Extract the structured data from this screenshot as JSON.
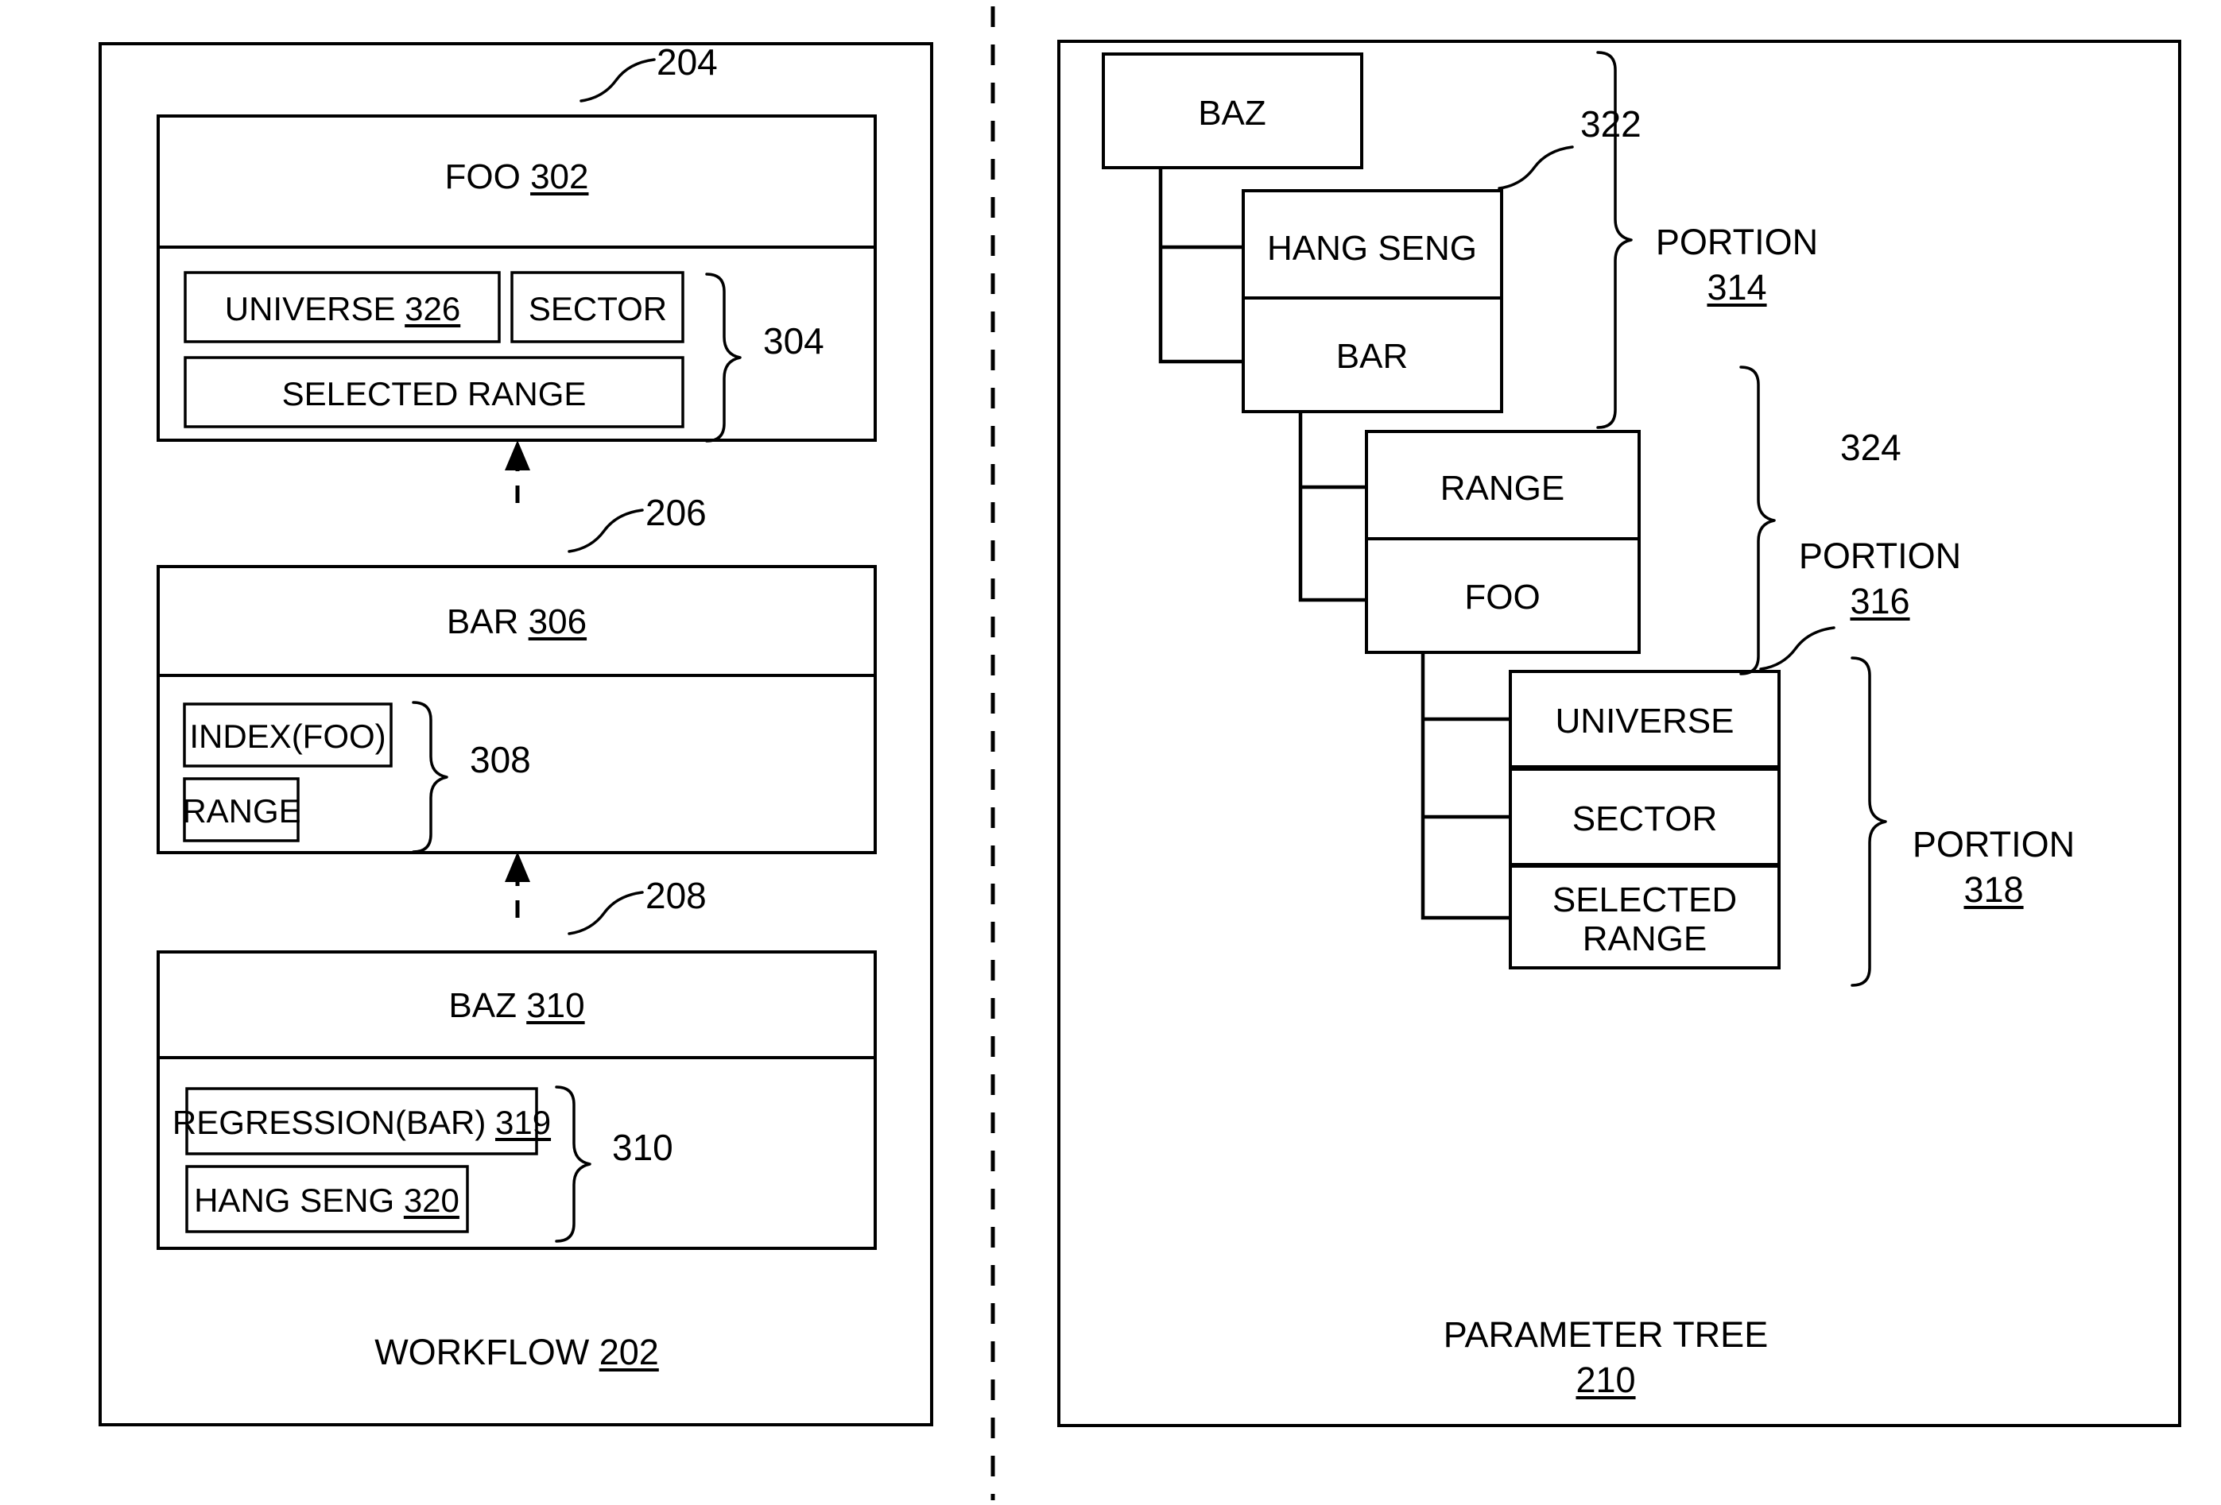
{
  "figure": {
    "left_panel": {
      "caption_text": "WORKFLOW",
      "caption_ref": "202",
      "callouts": {
        "foo_block": "204",
        "bar_block": "206",
        "baz_block": "208"
      },
      "blocks": [
        {
          "id": "foo-block",
          "header_text": "FOO",
          "header_ref": "302",
          "group_ref": "304",
          "items": [
            {
              "text": "UNIVERSE",
              "ref": "326"
            },
            {
              "text": "SECTOR",
              "ref": ""
            },
            {
              "text": "SELECTED RANGE",
              "ref": ""
            }
          ]
        },
        {
          "id": "bar-block",
          "header_text": "BAR",
          "header_ref": "306",
          "group_ref": "308",
          "items": [
            {
              "text": "INDEX(FOO)",
              "ref": ""
            },
            {
              "text": "RANGE",
              "ref": ""
            }
          ]
        },
        {
          "id": "baz-block",
          "header_text": "BAZ",
          "header_ref": "310",
          "group_ref": "310",
          "items": [
            {
              "text": "REGRESSION(BAR)",
              "ref": "319"
            },
            {
              "text": "HANG SENG",
              "ref": "320"
            }
          ]
        }
      ]
    },
    "right_panel": {
      "caption_text": "PARAMETER TREE",
      "caption_ref": "210",
      "callouts": {
        "hang_seng_node": "322",
        "universe_node": "324"
      },
      "nodes": [
        {
          "id": "node-baz",
          "label": "BAZ"
        },
        {
          "id": "node-hang-seng",
          "label": "HANG SENG"
        },
        {
          "id": "node-bar",
          "label": "BAR"
        },
        {
          "id": "node-range",
          "label": "RANGE"
        },
        {
          "id": "node-foo",
          "label": "FOO"
        },
        {
          "id": "node-universe",
          "label": "UNIVERSE"
        },
        {
          "id": "node-sector",
          "label": "SECTOR"
        },
        {
          "id": "node-selected-range-line1",
          "label": "SELECTED"
        },
        {
          "id": "node-selected-range-line2",
          "label": "RANGE"
        }
      ],
      "portions": [
        {
          "id": "portion-314",
          "word": "PORTION",
          "ref": "314"
        },
        {
          "id": "portion-316",
          "word": "PORTION",
          "ref": "316"
        },
        {
          "id": "portion-318",
          "word": "PORTION",
          "ref": "318"
        }
      ]
    }
  }
}
